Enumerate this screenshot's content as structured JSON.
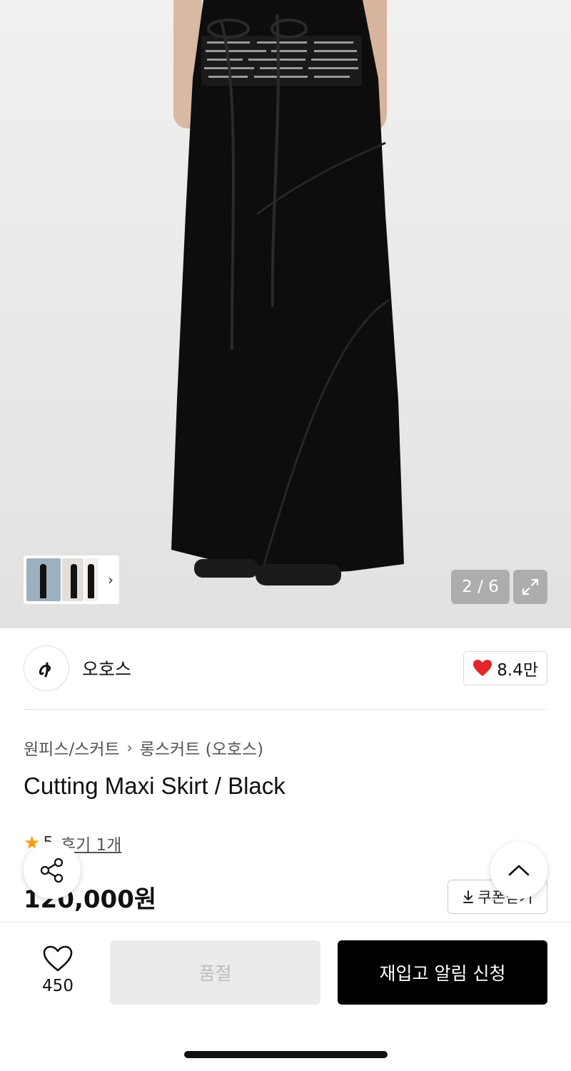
{
  "gallery": {
    "counter": "2 / 6"
  },
  "brand": {
    "name": "오호스",
    "likes": "8.4만"
  },
  "breadcrumb": {
    "category": "원피스/스커트",
    "subcategory": "롱스커트 (오호스)"
  },
  "product": {
    "title": "Cutting Maxi Skirt / Black",
    "rating": "5",
    "review_link": "후기 1개",
    "price": "120,000원"
  },
  "coupon": {
    "label": "쿠폰받기"
  },
  "bottom_bar": {
    "wish_count": "450",
    "soldout_label": "품절",
    "restock_label": "재입고 알림 신청"
  },
  "colors": {
    "star": "#ff9d0a",
    "heart": "#e3262c",
    "primary_button": "#000000",
    "disabled_button": "#ebebeb"
  }
}
